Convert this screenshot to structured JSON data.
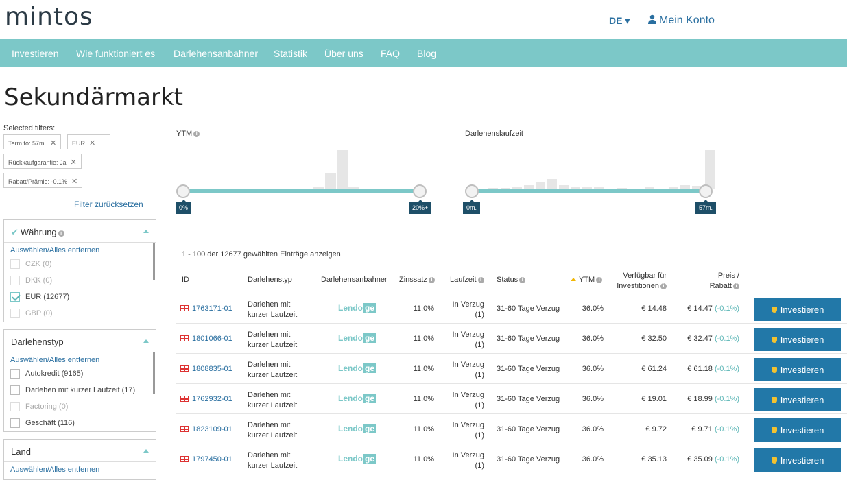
{
  "header": {
    "logo": "mintos",
    "lang": "DE ▾",
    "account": "Mein Konto"
  },
  "nav": [
    "Investieren",
    "Wie funktioniert es",
    "Darlehensanbahner",
    "Statistik",
    "Über uns",
    "FAQ",
    "Blog"
  ],
  "page_title": "Sekundärmarkt",
  "filters": {
    "selected_label": "Selected filters:",
    "chips": [
      "Term to: 57m.",
      "EUR",
      "Rückkaufgarantie: Ja",
      "Rabatt/Prämie: -0.1%"
    ],
    "reset": "Filter zurücksetzen",
    "select_all": "Auswählen/Alles entfernen",
    "currency": {
      "title": "Währung",
      "options": [
        "CZK (0)",
        "DKK (0)",
        "EUR (12677)",
        "GBP (0)"
      ]
    },
    "loan_type": {
      "title": "Darlehenstyp",
      "options": [
        "Autokredit (9165)",
        "Darlehen mit kurzer Laufzeit (17)",
        "Factoring (0)",
        "Geschäft (116)"
      ]
    },
    "country": {
      "title": "Land"
    }
  },
  "charts": {
    "ytm": {
      "label": "YTM",
      "min_tag": "0%",
      "max_tag": "20%+"
    },
    "term": {
      "label": "Darlehenslaufzeit",
      "min_tag": "0m.",
      "max_tag": "57m."
    }
  },
  "summary": "1 - 100 der 12677 gewählten Einträge anzeigen",
  "table": {
    "headers": {
      "id": "ID",
      "type": "Darlehenstyp",
      "originator": "Darlehensanbahner",
      "rate": "Zinssatz",
      "term": "Laufzeit",
      "status": "Status",
      "ytm": "YTM",
      "available_1": "Verfügbar für",
      "available_2": "Investitionen",
      "price_1": "Preis /",
      "price_2": "Rabatt"
    },
    "rows": [
      {
        "id": "1763171-01",
        "type_1": "Darlehen mit",
        "type_2": "kurzer Laufzeit",
        "originator": "Lendo",
        "originator_suffix": "ge",
        "rate": "11.0%",
        "term_1": "In Verzug",
        "term_2": "(1)",
        "status": "31-60 Tage Verzug",
        "ytm": "36.0%",
        "available": "€ 14.48",
        "price": "€ 14.47",
        "discount": "(-0.1%)",
        "button": "Investieren"
      },
      {
        "id": "1801066-01",
        "type_1": "Darlehen mit",
        "type_2": "kurzer Laufzeit",
        "originator": "Lendo",
        "originator_suffix": "ge",
        "rate": "11.0%",
        "term_1": "In Verzug",
        "term_2": "(1)",
        "status": "31-60 Tage Verzug",
        "ytm": "36.0%",
        "available": "€ 32.50",
        "price": "€ 32.47",
        "discount": "(-0.1%)",
        "button": "Investieren"
      },
      {
        "id": "1808835-01",
        "type_1": "Darlehen mit",
        "type_2": "kurzer Laufzeit",
        "originator": "Lendo",
        "originator_suffix": "ge",
        "rate": "11.0%",
        "term_1": "In Verzug",
        "term_2": "(1)",
        "status": "31-60 Tage Verzug",
        "ytm": "36.0%",
        "available": "€ 61.24",
        "price": "€ 61.18",
        "discount": "(-0.1%)",
        "button": "Investieren"
      },
      {
        "id": "1762932-01",
        "type_1": "Darlehen mit",
        "type_2": "kurzer Laufzeit",
        "originator": "Lendo",
        "originator_suffix": "ge",
        "rate": "11.0%",
        "term_1": "In Verzug",
        "term_2": "(1)",
        "status": "31-60 Tage Verzug",
        "ytm": "36.0%",
        "available": "€ 19.01",
        "price": "€ 18.99",
        "discount": "(-0.1%)",
        "button": "Investieren"
      },
      {
        "id": "1823109-01",
        "type_1": "Darlehen mit",
        "type_2": "kurzer Laufzeit",
        "originator": "Lendo",
        "originator_suffix": "ge",
        "rate": "11.0%",
        "term_1": "In Verzug",
        "term_2": "(1)",
        "status": "31-60 Tage Verzug",
        "ytm": "36.0%",
        "available": "€ 9.72",
        "price": "€ 9.71",
        "discount": "(-0.1%)",
        "button": "Investieren"
      },
      {
        "id": "1797450-01",
        "type_1": "Darlehen mit",
        "type_2": "kurzer Laufzeit",
        "originator": "Lendo",
        "originator_suffix": "ge",
        "rate": "11.0%",
        "term_1": "In Verzug",
        "term_2": "(1)",
        "status": "31-60 Tage Verzug",
        "ytm": "36.0%",
        "available": "€ 35.13",
        "price": "€ 35.09",
        "discount": "(-0.1%)",
        "button": "Investieren"
      }
    ]
  },
  "colors": {
    "nav": "#7cc8c8",
    "button": "#2278a8",
    "link": "#2a6fa0",
    "tag": "#1e4f68"
  }
}
